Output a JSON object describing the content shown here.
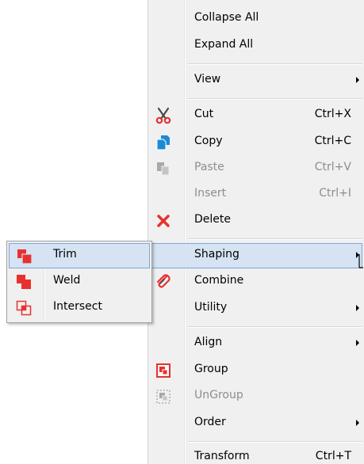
{
  "context_menu": {
    "items": [
      {
        "label": "Collapse All",
        "shortcut": "",
        "icon": "",
        "disabled": false,
        "submenu": false
      },
      {
        "label": "Expand All",
        "shortcut": "",
        "icon": "",
        "disabled": false,
        "submenu": false
      },
      {
        "label": "View",
        "shortcut": "",
        "icon": "",
        "disabled": false,
        "submenu": true
      },
      {
        "label": "Cut",
        "shortcut": "Ctrl+X",
        "icon": "scissors-icon",
        "disabled": false,
        "submenu": false
      },
      {
        "label": "Copy",
        "shortcut": "Ctrl+C",
        "icon": "copy-icon",
        "disabled": false,
        "submenu": false
      },
      {
        "label": "Paste",
        "shortcut": "Ctrl+V",
        "icon": "paste-icon",
        "disabled": true,
        "submenu": false
      },
      {
        "label": "Insert",
        "shortcut": "Ctrl+I",
        "icon": "",
        "disabled": true,
        "submenu": false
      },
      {
        "label": "Delete",
        "shortcut": "",
        "icon": "delete-x-icon",
        "disabled": false,
        "submenu": false
      },
      {
        "label": "Shaping",
        "shortcut": "",
        "icon": "",
        "disabled": false,
        "submenu": true,
        "highlighted": true
      },
      {
        "label": "Combine",
        "shortcut": "",
        "icon": "paperclip-icon",
        "disabled": false,
        "submenu": false
      },
      {
        "label": "Utility",
        "shortcut": "",
        "icon": "",
        "disabled": false,
        "submenu": true
      },
      {
        "label": "Align",
        "shortcut": "",
        "icon": "",
        "disabled": false,
        "submenu": true
      },
      {
        "label": "Group",
        "shortcut": "",
        "icon": "group-icon",
        "disabled": false,
        "submenu": false
      },
      {
        "label": "UnGroup",
        "shortcut": "",
        "icon": "ungroup-icon",
        "disabled": true,
        "submenu": false
      },
      {
        "label": "Order",
        "shortcut": "",
        "icon": "",
        "disabled": false,
        "submenu": true
      },
      {
        "label": "Transform",
        "shortcut": "Ctrl+T",
        "icon": "",
        "disabled": false,
        "submenu": false
      }
    ]
  },
  "shaping_submenu": {
    "items": [
      {
        "label": "Trim",
        "icon": "trim-icon",
        "highlighted": true
      },
      {
        "label": "Weld",
        "icon": "weld-icon",
        "highlighted": false
      },
      {
        "label": "Intersect",
        "icon": "intersect-icon",
        "highlighted": false
      }
    ]
  },
  "colors": {
    "menu_background": "#f0f0f0",
    "highlight_background": "#d5e3f3",
    "highlight_border": "#7ea7d8",
    "disabled_text": "#8d8d8d",
    "icon_red": "#e8312f",
    "icon_blue": "#1c8ad6"
  }
}
